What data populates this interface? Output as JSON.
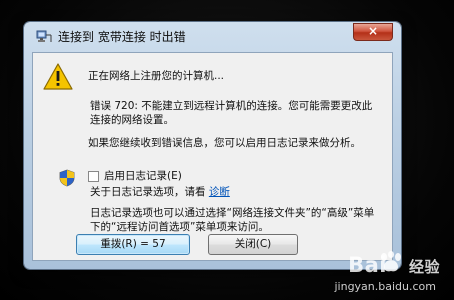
{
  "window": {
    "title": "连接到 宽带连接 时出错",
    "close_glyph": "×"
  },
  "message": {
    "status": "正在网络上注册您的计算机...",
    "error_line1": "错误 720: 不能建立到远程计算机的连接。您可能需要更改此",
    "error_line2": "连接的网络设置。",
    "hint": "如果您继续收到错误信息，您可以启用日志记录来做分析。"
  },
  "logging": {
    "checkbox_label": "启用日志记录(E)",
    "info_prefix": "关于日志记录选项，请看",
    "info_link": "诊断",
    "desc_line1": "日志记录选项也可以通过选择“网络连接文件夹”的“高级”菜单",
    "desc_line2": "下的“远程访问首选项”菜单项来访问。"
  },
  "buttons": {
    "redial": "重拨(R) = 57",
    "close": "关闭(C)"
  },
  "watermark": {
    "brand": "Bai",
    "brand_cn": "经验",
    "url": "jingyan.baidu.com"
  }
}
